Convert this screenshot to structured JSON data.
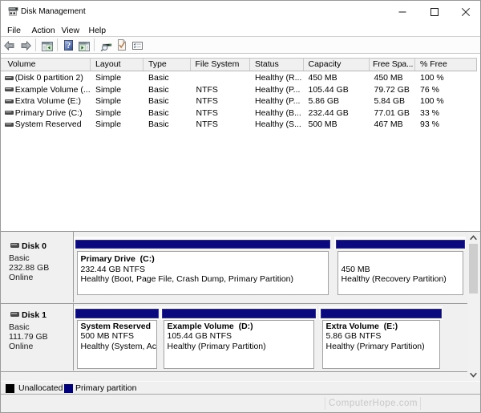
{
  "window": {
    "title": "Disk Management",
    "controls": {
      "minimize": "minimize",
      "maximize": "maximize",
      "close": "close"
    }
  },
  "menu": {
    "items": [
      "File",
      "Action",
      "View",
      "Help"
    ]
  },
  "toolbar": {
    "buttons": [
      "back",
      "forward",
      "show-hide-console-tree",
      "help",
      "show-hide-action-pane",
      "rescan-disks",
      "check-disk",
      "properties"
    ]
  },
  "table": {
    "columns": [
      "Volume",
      "Layout",
      "Type",
      "File System",
      "Status",
      "Capacity",
      "Free Spa...",
      "% Free"
    ],
    "rows": [
      {
        "volume": "(Disk 0 partition 2)",
        "layout": "Simple",
        "type": "Basic",
        "fs": "",
        "status": "Healthy (R...",
        "capacity": "450 MB",
        "free": "450 MB",
        "pct": "100 %"
      },
      {
        "volume": "Example Volume (...",
        "layout": "Simple",
        "type": "Basic",
        "fs": "NTFS",
        "status": "Healthy (P...",
        "capacity": "105.44 GB",
        "free": "79.72 GB",
        "pct": "76 %"
      },
      {
        "volume": "Extra Volume (E:)",
        "layout": "Simple",
        "type": "Basic",
        "fs": "NTFS",
        "status": "Healthy (P...",
        "capacity": "5.86 GB",
        "free": "5.84 GB",
        "pct": "100 %"
      },
      {
        "volume": "Primary Drive (C:)",
        "layout": "Simple",
        "type": "Basic",
        "fs": "NTFS",
        "status": "Healthy (B...",
        "capacity": "232.44 GB",
        "free": "77.01 GB",
        "pct": "33 %"
      },
      {
        "volume": "System Reserved",
        "layout": "Simple",
        "type": "Basic",
        "fs": "NTFS",
        "status": "Healthy (S...",
        "capacity": "500 MB",
        "free": "467 MB",
        "pct": "93 %"
      }
    ]
  },
  "disks": [
    {
      "name": "Disk 0",
      "kind": "Basic",
      "size": "232.88 GB",
      "state": "Online",
      "partitions": [
        {
          "label": "Primary Drive  (C:)",
          "size_fs": "232.44 GB NTFS",
          "status": "Healthy (Boot, Page File, Crash Dump, Primary Partition)"
        },
        {
          "label": "",
          "size_fs": "450 MB",
          "status": "Healthy (Recovery Partition)"
        }
      ]
    },
    {
      "name": "Disk 1",
      "kind": "Basic",
      "size": "111.79 GB",
      "state": "Online",
      "partitions": [
        {
          "label": "System Reserved",
          "size_fs": "500 MB NTFS",
          "status": "Healthy (System, Active, Primary Partition)"
        },
        {
          "label": "Example Volume  (D:)",
          "size_fs": "105.44 GB NTFS",
          "status": "Healthy (Primary Partition)"
        },
        {
          "label": "Extra Volume  (E:)",
          "size_fs": "5.86 GB NTFS",
          "status": "Healthy (Primary Partition)"
        }
      ]
    }
  ],
  "legend": {
    "items": [
      {
        "label": "Unallocated",
        "color": "#000000"
      },
      {
        "label": "Primary partition",
        "color": "#00007b"
      }
    ]
  },
  "statusbar": {
    "watermark": "ComputerHope.com"
  },
  "colors": {
    "partition_bar": "#0a0a7e",
    "pane_bg": "#f0f0f0",
    "accent_border": "#9a9a9a"
  }
}
